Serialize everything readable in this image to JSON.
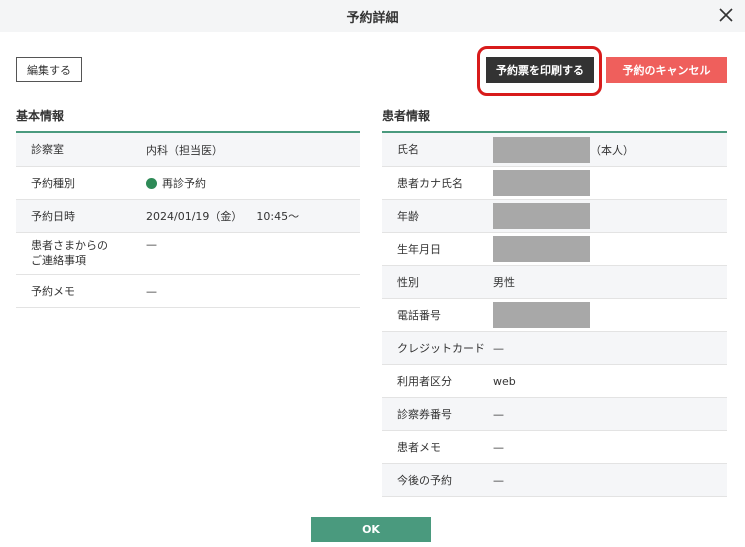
{
  "dialog": {
    "title": "予約詳細"
  },
  "toolbar": {
    "edit_label": "編集する",
    "print_label": "予約票を印刷する",
    "cancel_label": "予約のキャンセル"
  },
  "basic": {
    "heading": "基本情報",
    "rows": [
      {
        "label": "診察室",
        "value": "内科（担当医）"
      },
      {
        "label": "予約種別",
        "value": "再診予約"
      },
      {
        "label": "予約日時",
        "date": "2024/01/19（金）",
        "time": "10:45〜"
      },
      {
        "label_line1": "患者さまからの",
        "label_line2": "ご連絡事項",
        "value": "—"
      },
      {
        "label": "予約メモ",
        "value": "—"
      }
    ]
  },
  "patient": {
    "heading": "患者情報",
    "rows": [
      {
        "label": "氏名",
        "suffix": "（本人）"
      },
      {
        "label": "患者カナ氏名"
      },
      {
        "label": "年齢"
      },
      {
        "label": "生年月日"
      },
      {
        "label": "性別",
        "value": "男性"
      },
      {
        "label": "電話番号"
      },
      {
        "label": "クレジットカード",
        "value": "—"
      },
      {
        "label": "利用者区分",
        "value": "web"
      },
      {
        "label": "診察券番号",
        "value": "—"
      },
      {
        "label": "患者メモ",
        "value": "—"
      },
      {
        "label": "今後の予約",
        "value": "—"
      }
    ]
  },
  "footer": {
    "ok_label": "OK"
  },
  "colors": {
    "accent": "#4a9a7e",
    "cancel": "#ef5f5c",
    "print": "#333333",
    "highlight": "#d81b1b",
    "status_dot": "#2e8a57"
  },
  "icons": {
    "close": "close-icon",
    "status": "status-dot-icon"
  }
}
